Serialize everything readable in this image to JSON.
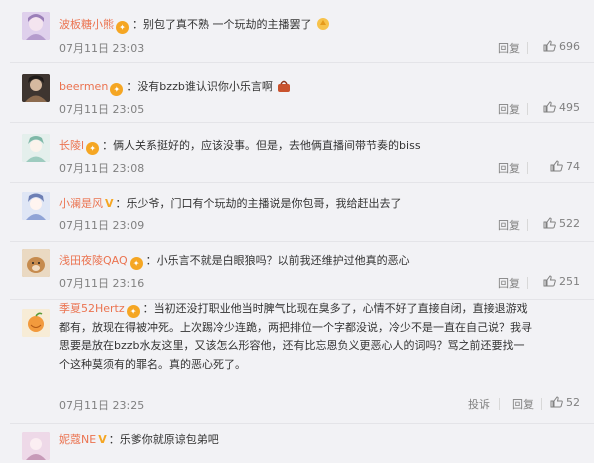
{
  "comments": [
    {
      "user": "波板糖小熊",
      "badge": "vip",
      "text": "别包了真不熟 一个玩劫的主播罢了",
      "emoji": "clap-emoji",
      "time": "07月11日 23:03",
      "reply": "回复",
      "likes": "696",
      "avatar_color": "#c9b4d8"
    },
    {
      "user": "beermen",
      "badge": "vip",
      "text": "没有bzzb谁认识你小乐言啊",
      "emoji": "bag-emoji",
      "time": "07月11日 23:05",
      "reply": "回复",
      "likes": "495",
      "avatar_color": "#5b4a3e"
    },
    {
      "user": "长陵l",
      "badge": "vip",
      "text": "俩人关系挺好的，应该没事。但是，去他俩直播间带节奏的biss",
      "time": "07月11日 23:08",
      "reply": "回复",
      "likes": "74",
      "avatar_color": "#cfe3de"
    },
    {
      "user": "小澜是风",
      "badge": "verified",
      "text": "乐少爷，门口有个玩劫的主播说是你包哥，我给赶出去了",
      "time": "07月11日 23:09",
      "reply": "回复",
      "likes": "522",
      "avatar_color": "#b9c6e6"
    },
    {
      "user": "浅田夜陵QAQ",
      "badge": "vip",
      "text": "小乐言不就是白眼狼吗？以前我还维护过他真的恶心",
      "time": "07月11日 23:16",
      "reply": "回复",
      "likes": "251",
      "avatar_color": "#c8a173"
    },
    {
      "user": "季夏52Hertz",
      "badge": "vip",
      "text_lines": [
        "当初还没打职业他当时脾气比现在臭多了，心情不好了直接自闭，直接退游戏",
        "都有，放现在得被冲死。上次踢冷少连跪，两把排位一个字都没说，冷少不是一直在自己说？我寻",
        "思要是放在bzzb水友这里，又该怎么形容他，还有比忘恩负义更恶心人的词吗？骂之前还要找一",
        "个这种莫须有的罪名。真的恶心死了。"
      ],
      "time": "07月11日 23:25",
      "report": "投诉",
      "reply": "回复",
      "likes": "52",
      "avatar_color": "#f3e3c6"
    },
    {
      "user": "妮蔻NE",
      "badge": "verified",
      "text": "乐爹你就原谅包弟吧",
      "avatar_color": "#e3c8dc"
    }
  ],
  "colors": {
    "username": "#eb7350",
    "meta": "#808080",
    "badge": "#f5a623"
  }
}
